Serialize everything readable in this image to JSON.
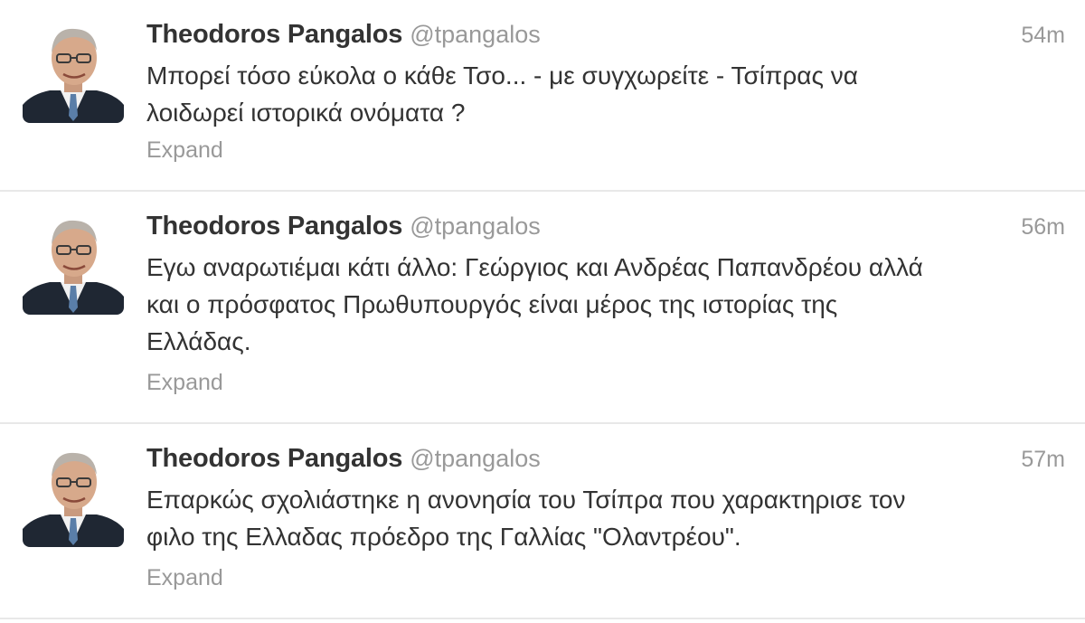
{
  "tweets": [
    {
      "author_name": "Theodoros Pangalos",
      "author_handle": "@tpangalos",
      "time": "54m",
      "text_lines": [
        "Μπορεί τόσο εύκολα ο κάθε Τσο... - με συγχωρείτε - Τσίπρας να",
        "λοιδωρεί ιστορικά ονόματα ?"
      ],
      "expand_label": "Expand",
      "avatar_icon": "profile-photo-icon"
    },
    {
      "author_name": "Theodoros Pangalos",
      "author_handle": "@tpangalos",
      "time": "56m",
      "text_lines": [
        "Εγω αναρωτιέμαι κάτι άλλο: Γεώργιος και Ανδρέας Παπανδρέου αλλά",
        "και ο πρόσφατος Πρωθυπουργός είναι μέρος της ιστορίας της",
        "Ελλάδας."
      ],
      "expand_label": "Expand",
      "avatar_icon": "profile-photo-icon"
    },
    {
      "author_name": "Theodoros Pangalos",
      "author_handle": "@tpangalos",
      "time": "57m",
      "text_lines": [
        "Επαρκώς σχολιάστηκε η ανονησία του Τσίπρα που χαρακτηρισε τον",
        "φιλο της Ελλαδας πρόεδρο της Γαλλίας \"Ολαντρέου\"."
      ],
      "expand_label": "Expand",
      "avatar_icon": "profile-photo-icon"
    }
  ],
  "colors": {
    "name": "#333333",
    "secondary": "#999999",
    "divider": "#e8e8e8",
    "background": "#ffffff"
  }
}
